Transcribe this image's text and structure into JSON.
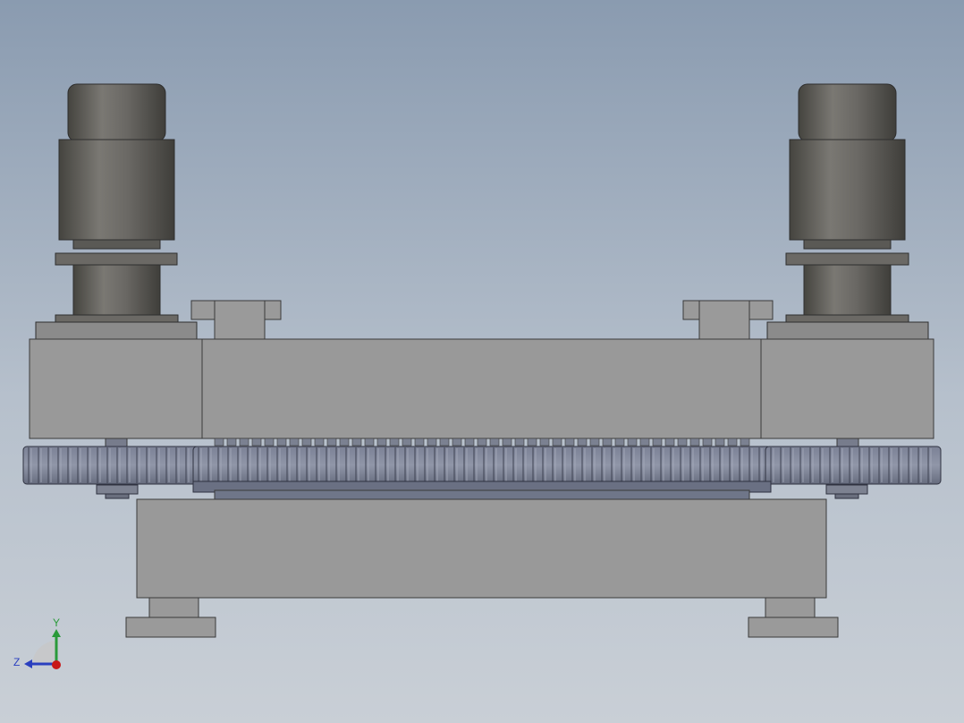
{
  "viewport": {
    "background_top": "#8a9bb0",
    "background_bottom": "#c9cfd6"
  },
  "model": {
    "colors": {
      "body_gray": "#999999",
      "body_gray_dark": "#8f8f8f",
      "outline": "#3a3a3a",
      "gear_blue": "#6f7689",
      "gear_blue_light": "#8a90a2",
      "motor_dark": "#4d4c49",
      "motor_mid": "#6b6965",
      "motor_light": "#85837e"
    }
  },
  "triad": {
    "y_label": "Y",
    "z_label": "Z",
    "y_color": "#2a9a3a",
    "z_color": "#2a3fbf",
    "x_color": "#c81818"
  }
}
